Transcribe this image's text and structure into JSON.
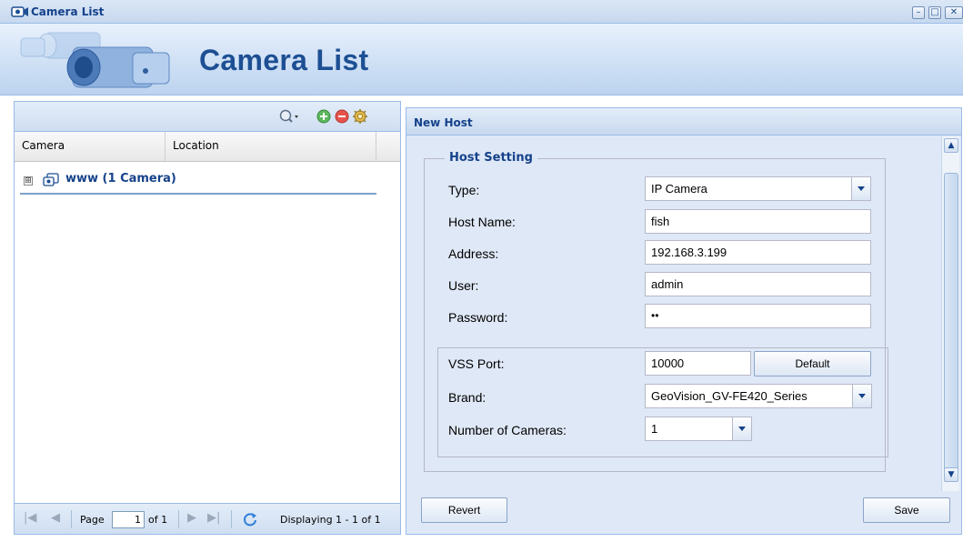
{
  "window": {
    "title": "Camera List",
    "controls": [
      "minimize-icon",
      "maximize-icon",
      "close-icon"
    ]
  },
  "banner": {
    "title": "Camera List"
  },
  "camera_panel": {
    "toolbar_icons": [
      "search-icon",
      "add-icon",
      "remove-icon",
      "settings-icon"
    ],
    "columns": [
      "Camera",
      "Location"
    ],
    "tree": [
      {
        "label": "www (1 Camera)",
        "expander": "⊞"
      }
    ],
    "pager": {
      "page_label": "Page",
      "page_value": "1",
      "of_label": "of 1",
      "display_text": "Displaying 1 - 1 of 1"
    }
  },
  "host_panel": {
    "title": "New Host",
    "legend": "Host Setting",
    "fields": {
      "type": {
        "label": "Type:",
        "value": "IP Camera"
      },
      "host_name": {
        "label": "Host Name:",
        "value": "fish"
      },
      "address": {
        "label": "Address:",
        "value": "192.168.3.199"
      },
      "user": {
        "label": "User:",
        "value": "admin"
      },
      "password": {
        "label": "Password:",
        "value": "••"
      },
      "vss_port": {
        "label": "VSS Port:",
        "value": "10000",
        "button": "Default"
      },
      "brand": {
        "label": "Brand:",
        "value": "GeoVision_GV-FE420_Series"
      },
      "num_cameras": {
        "label": "Number of Cameras:",
        "value": "1"
      }
    },
    "buttons": {
      "revert": "Revert",
      "save": "Save"
    }
  },
  "colors": {
    "accent": "#15428b",
    "panel_bg": "#dfe8f6",
    "border": "#99bbe8"
  }
}
